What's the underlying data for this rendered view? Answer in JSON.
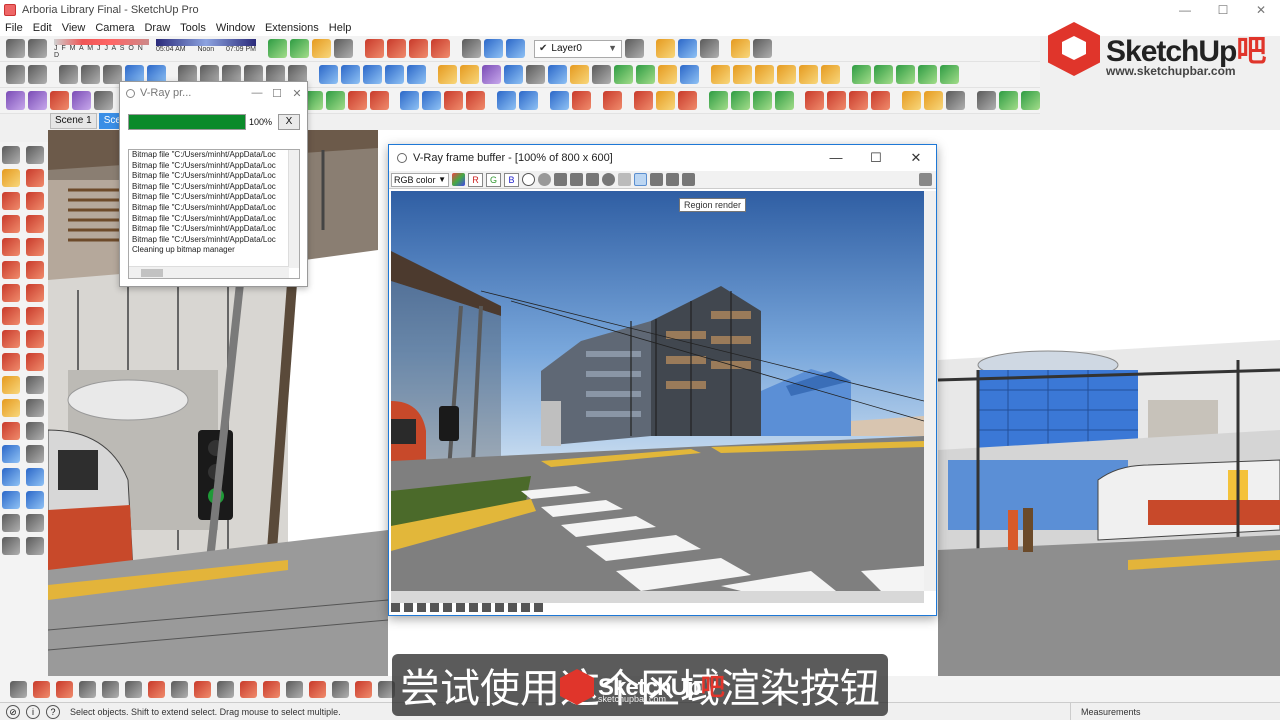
{
  "window": {
    "title": "Arboria Library Final - SketchUp Pro",
    "controls": [
      "—",
      "☐",
      "✕"
    ]
  },
  "menu": [
    "File",
    "Edit",
    "View",
    "Camera",
    "Draw",
    "Tools",
    "Window",
    "Extensions",
    "Help"
  ],
  "shadow_settings": {
    "months": "J F M A M J J A S O N D",
    "time_start": "05:04 AM",
    "time_mid": "Noon",
    "time_end": "07:09 PM"
  },
  "layer": {
    "selected": "Layer0"
  },
  "logo": {
    "brand": "SketchUp",
    "brand_accent": "吧",
    "url": "www.sketchupbar.com"
  },
  "scenes": [
    "Scene 1",
    "Scene"
  ],
  "vray_progress": {
    "title": "V-Ray pr...",
    "percent": "100%",
    "progress_fraction": 1.0,
    "close_label": "X",
    "log": [
      "Bitmap file \"C:/Users/minht/AppData/Loc",
      "Bitmap file \"C:/Users/minht/AppData/Loc",
      "Bitmap file \"C:/Users/minht/AppData/Loc",
      "Bitmap file \"C:/Users/minht/AppData/Loc",
      "Bitmap file \"C:/Users/minht/AppData/Loc",
      "Bitmap file \"C:/Users/minht/AppData/Loc",
      "Bitmap file \"C:/Users/minht/AppData/Loc",
      "Bitmap file \"C:/Users/minht/AppData/Loc",
      "Bitmap file \"C:/Users/minht/AppData/Loc",
      "Cleaning up bitmap manager"
    ]
  },
  "frame_buffer": {
    "title": "V-Ray frame buffer - [100% of 800 x 600]",
    "color_mode": "RGB color",
    "channels": [
      "R",
      "G",
      "B"
    ],
    "tooltip": "Region render"
  },
  "status": {
    "message": "Select objects. Shift to extend select. Drag mouse to select multiple.",
    "measurements_label": "Measurements"
  },
  "subtitle": {
    "text": "尝试使用这个区域渲染按钮",
    "logo_brand": "SketchUp",
    "logo_accent": "吧",
    "logo_url": "sketchupbar.com"
  },
  "colors": {
    "accent_red": "#e0352b",
    "progress_green": "#0a8a2a",
    "selection_blue": "#1e78d6"
  }
}
